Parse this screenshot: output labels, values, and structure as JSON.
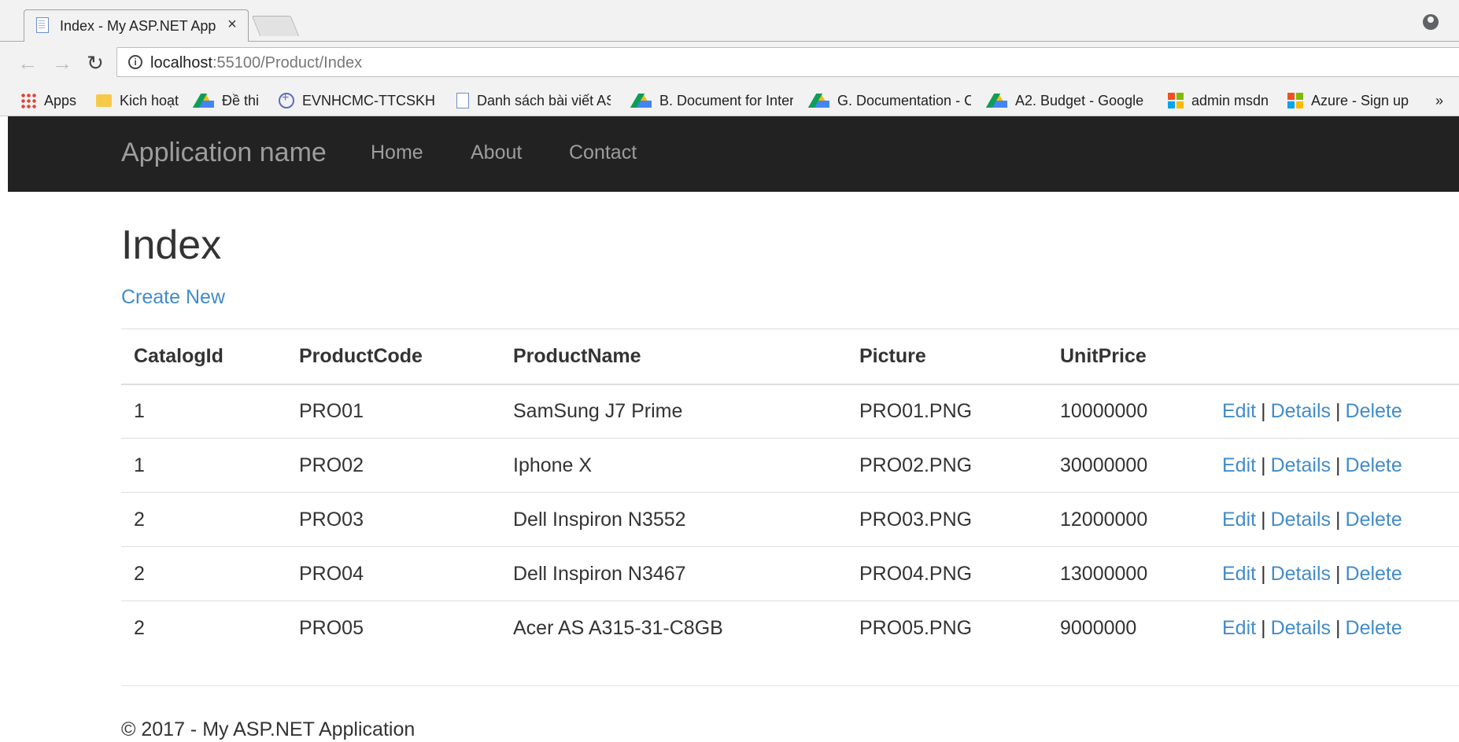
{
  "browser": {
    "tab_title": "Index - My ASP.NET Appl",
    "tab_close": "×",
    "url_host": "localhost",
    "url_rest": ":55100/Product/Index",
    "bookmarks": [
      {
        "label": "Apps",
        "icon": "apps-grid-icon"
      },
      {
        "label": "Kich hoạt",
        "icon": "folder-icon"
      },
      {
        "label": "Đề thi",
        "icon": "google-drive-icon"
      },
      {
        "label": "EVNHCMC-TTCSKH |",
        "icon": "globe-icon"
      },
      {
        "label": "Danh sách bài viết AS",
        "icon": "document-icon"
      },
      {
        "label": "B. Document for Inter",
        "icon": "google-drive-icon"
      },
      {
        "label": "G. Documentation - C",
        "icon": "google-drive-icon"
      },
      {
        "label": "A2. Budget - Google",
        "icon": "google-drive-icon"
      },
      {
        "label": "admin msdn",
        "icon": "microsoft-icon"
      },
      {
        "label": "Azure - Sign up",
        "icon": "microsoft-icon"
      }
    ],
    "bookmarks_more": "»"
  },
  "site": {
    "brand": "Application name",
    "nav": [
      "Home",
      "About",
      "Contact"
    ],
    "page_title": "Index",
    "create_link": "Create New",
    "table": {
      "headers": [
        "CatalogId",
        "ProductCode",
        "ProductName",
        "Picture",
        "UnitPrice"
      ],
      "rows": [
        [
          "1",
          "PRO01",
          "SamSung J7 Prime",
          "PRO01.PNG",
          "10000000"
        ],
        [
          "1",
          "PRO02",
          "Iphone X",
          "PRO02.PNG",
          "30000000"
        ],
        [
          "2",
          "PRO03",
          "Dell Inspiron N3552",
          "PRO03.PNG",
          "12000000"
        ],
        [
          "2",
          "PRO04",
          "Dell Inspiron N3467",
          "PRO04.PNG",
          "13000000"
        ],
        [
          "2",
          "PRO05",
          "Acer AS A315-31-C8GB",
          "PRO05.PNG",
          "9000000"
        ]
      ],
      "actions": {
        "edit": "Edit",
        "details": "Details",
        "delete": "Delete",
        "separator": "|"
      }
    },
    "footer": "© 2017 - My ASP.NET Application"
  },
  "colors": {
    "navbar_bg": "#222222",
    "navbar_text": "#9d9d9d",
    "link": "#428bca",
    "text": "#333333"
  }
}
